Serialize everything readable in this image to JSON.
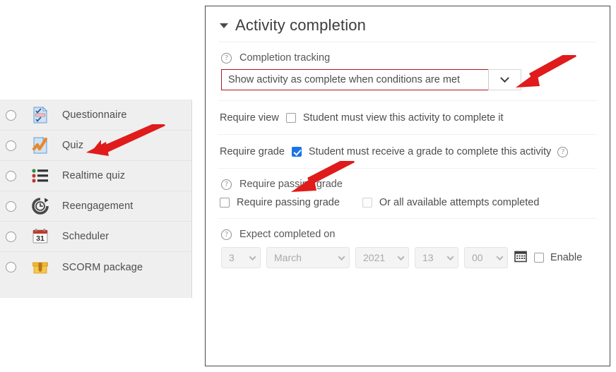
{
  "activity_chooser": {
    "items": [
      {
        "label": "Questionnaire",
        "icon": "questionnaire-icon",
        "selected": false
      },
      {
        "label": "Quiz",
        "icon": "quiz-icon",
        "selected": false
      },
      {
        "label": "Realtime quiz",
        "icon": "realtime-quiz-icon",
        "selected": false
      },
      {
        "label": "Reengagement",
        "icon": "reengagement-icon",
        "selected": false
      },
      {
        "label": "Scheduler",
        "icon": "scheduler-icon",
        "selected": false
      },
      {
        "label": "SCORM package",
        "icon": "scorm-package-icon",
        "selected": false
      }
    ]
  },
  "panel": {
    "title": "Activity completion",
    "collapse_icon": "caret-down-icon",
    "completion_tracking": {
      "help_icon": "help-circle-icon",
      "label": "Completion tracking",
      "selected_value": "Show activity as complete when conditions are met",
      "dropdown_icon": "chevron-down-icon"
    },
    "require_view": {
      "label": "Require view",
      "checked": false,
      "description": "Student must view this activity to complete it"
    },
    "require_grade": {
      "label": "Require grade",
      "checked": true,
      "description": "Student must receive a grade to complete this activity",
      "help_icon": "help-circle-icon"
    },
    "require_passing_grade": {
      "help_icon": "help-circle-icon",
      "group_label": "Require passing grade",
      "checkbox_label": "Require passing grade",
      "checkbox_checked": false,
      "alt_checkbox_label": "Or all available attempts completed",
      "alt_checkbox_checked": false
    },
    "expect_completed_on": {
      "help_icon": "help-circle-icon",
      "label": "Expect completed on",
      "day": "3",
      "month": "March",
      "year": "2021",
      "hour": "13",
      "minute": "00",
      "calendar_icon": "calendar-icon",
      "enable_label": "Enable",
      "enable_checked": false
    }
  },
  "annotations": {
    "arrow_color": "#e01b1b",
    "arrows": [
      {
        "name": "arrow-to-quiz",
        "points_to": "Quiz"
      },
      {
        "name": "arrow-to-completion-tracking-dropdown",
        "points_to": "Show activity as complete when conditions are met"
      },
      {
        "name": "arrow-to-require-grade-checkbox",
        "points_to": "Require grade"
      }
    ]
  },
  "colors": {
    "highlight_border": "#b01420",
    "checkbox_checked": "#1a73e8",
    "panel_border": "#4a4a4a",
    "sidebar_bg": "#efefef"
  }
}
